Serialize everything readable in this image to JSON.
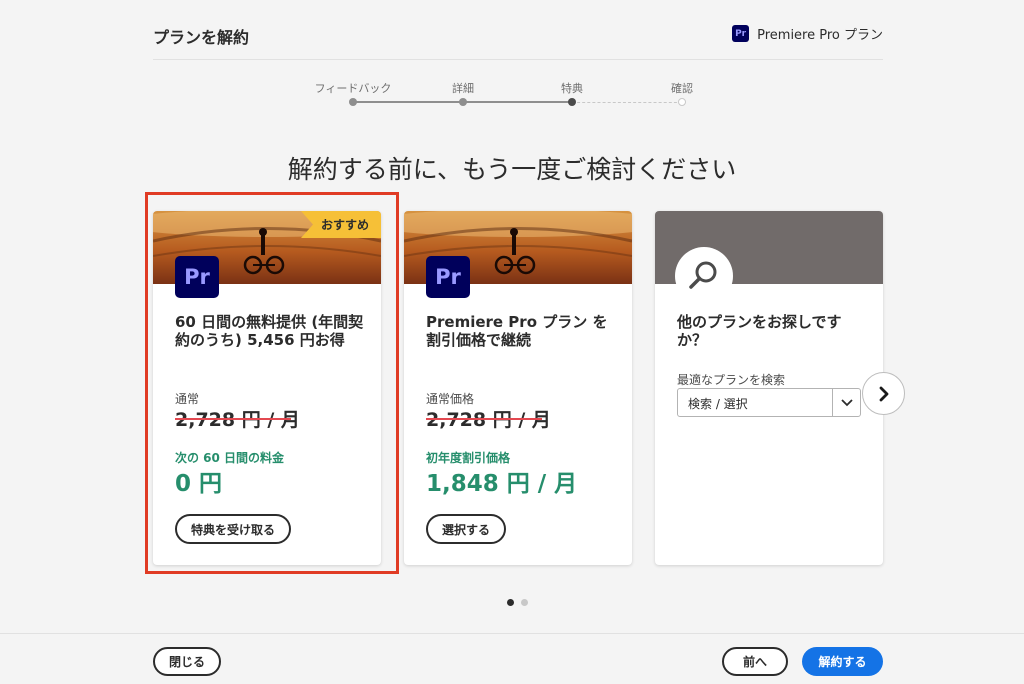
{
  "header": {
    "title": "プランを解約",
    "plan_icon": "Pr",
    "plan_name": "Premiere Pro プラン"
  },
  "stepper": {
    "steps": [
      {
        "label": "フィードバック",
        "state": "done"
      },
      {
        "label": "詳細",
        "state": "done"
      },
      {
        "label": "特典",
        "state": "current"
      },
      {
        "label": "確認",
        "state": "pending"
      }
    ]
  },
  "main_title": "解約する前に、もう一度ご検討ください",
  "cards": [
    {
      "ribbon": "おすすめ",
      "icon": "Pr",
      "title": "60 日間の無料提供 (年間契約のうち) 5,456 円お得",
      "regular_label": "通常",
      "regular_price": "2,728 円 / 月",
      "offer_label": "次の 60 日間の料金",
      "offer_price": "0 円",
      "button": "特典を受け取る",
      "selected": true
    },
    {
      "icon": "Pr",
      "title": "Premiere Pro プラン を割引価格で継続",
      "regular_label": "通常価格",
      "regular_price": "2,728 円 / 月",
      "offer_label": "初年度割引価格",
      "offer_price": "1,848 円 / 月",
      "button": "選択する"
    },
    {
      "icon": "search-icon",
      "title": "他のプランをお探しですか？",
      "dropdown_label": "最適なプランを検索",
      "dropdown_value": "検索 / 選択"
    }
  ],
  "pager": {
    "count": 2,
    "active": 0
  },
  "footer": {
    "close": "閉じる",
    "back": "前へ",
    "cancel": "解約する"
  },
  "colors": {
    "accent_blue": "#1473e6",
    "green": "#268e6c",
    "highlight_red": "#e03b24",
    "ribbon_yellow": "#f6c037",
    "premiere_bg": "#00005b",
    "premiere_text": "#9999ff"
  }
}
